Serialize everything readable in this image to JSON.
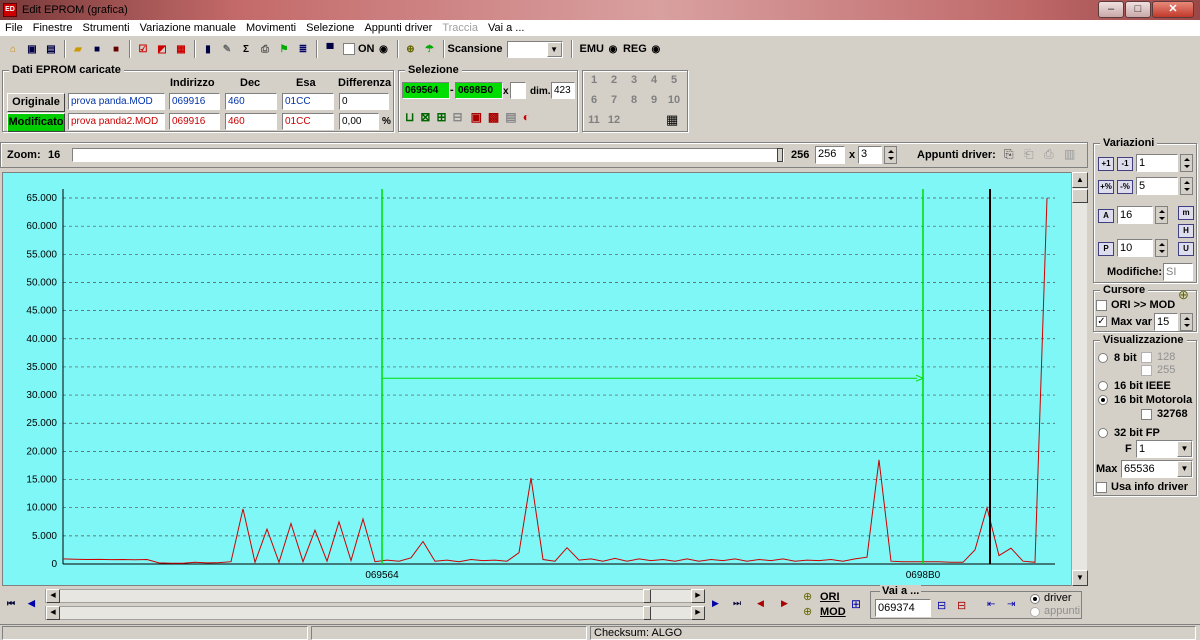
{
  "window": {
    "title": "Edit EPROM (grafica)",
    "icon_text": "EDT\nEPROM"
  },
  "menu": [
    "File",
    "Finestre",
    "Strumenti",
    "Variazione manuale",
    "Movimenti",
    "Selezione",
    "Appunti driver",
    "Traccia",
    "Vai a ..."
  ],
  "menu_disabled": [
    7
  ],
  "toolbar": {
    "on_label": "ON",
    "scansione_label": "Scansione",
    "scansione_value": "",
    "emu_label": "EMU",
    "reg_label": "REG",
    "on_checked": false
  },
  "dati": {
    "title": "Dati EPROM caricate",
    "headers": {
      "indirizzo": "Indirizzo",
      "dec": "Dec",
      "esa": "Esa",
      "differenza": "Differenza"
    },
    "originale": {
      "label": "Originale",
      "file": "prova panda.MOD",
      "indirizzo": "069916",
      "dec": "460",
      "esa": "01CC",
      "differenza": "0"
    },
    "modificato": {
      "label": "Modificato",
      "file": "prova panda2.MOD",
      "indirizzo": "069916",
      "dec": "460",
      "esa": "01CC",
      "differenza": "0,00",
      "unit": "%"
    }
  },
  "selezione": {
    "title": "Selezione",
    "start": "069564",
    "end": "0698B0",
    "x": "x",
    "dim_label": "dim.",
    "dim": "423"
  },
  "numgrid": [
    "1",
    "2",
    "3",
    "4",
    "5",
    "6",
    "7",
    "8",
    "9",
    "10",
    "11",
    "12"
  ],
  "zoom": {
    "label": "Zoom:",
    "value": "16",
    "max": "256",
    "field": "256",
    "x": "x",
    "mult": "3",
    "appunti_label": "Appunti driver:"
  },
  "chart_data": {
    "type": "line",
    "y_ticks": [
      "65.000",
      "60.000",
      "55.000",
      "50.000",
      "45.000",
      "40.000",
      "35.000",
      "30.000",
      "25.000",
      "20.000",
      "15.000",
      "10.000",
      "5.000",
      "0"
    ],
    "ylim": [
      0,
      65536
    ],
    "x_markers": [
      "069564",
      "0698B0"
    ],
    "background_color": "#7ff7f7",
    "line_color": "#cc0000",
    "selection_color": "#00dd00",
    "cursor_color": "#000000",
    "series": [
      {
        "values": [
          900,
          850,
          800,
          820,
          780,
          800,
          760,
          800,
          200,
          150,
          150,
          300,
          200,
          250,
          400,
          9800,
          300,
          6200,
          300,
          7200,
          400,
          6000,
          500,
          7500,
          600,
          8000,
          400,
          700,
          500,
          1100,
          4000,
          500,
          700,
          400,
          800,
          600,
          700,
          500,
          2000,
          15300,
          800,
          500,
          2900,
          700,
          900,
          500,
          1000,
          500,
          900,
          600,
          800,
          500,
          900,
          500,
          800,
          600,
          900,
          500,
          800,
          600,
          900,
          500,
          700,
          600,
          800,
          500,
          900,
          1200,
          18500,
          500,
          400,
          400,
          400,
          400,
          300,
          300,
          2500,
          10000,
          1500,
          2800,
          500,
          300,
          65000
        ]
      }
    ]
  },
  "variazioni": {
    "title": "Variazioni",
    "field1": "1",
    "field2": "5",
    "field3": "16",
    "field4": "10",
    "modifiche_label": "Modifiche:",
    "modifiche_value": "SI"
  },
  "cursore": {
    "title": "Cursore",
    "ori_mod": "ORI >> MOD",
    "maxvar_label": "Max var",
    "maxvar_value": "15"
  },
  "visualizzazione": {
    "title": "Visualizzazione",
    "bit8": "8 bit",
    "v128": "128",
    "v255": "255",
    "ieee": "16 bit IEEE",
    "motorola": "16 bit Motorola",
    "v32768": "32768",
    "fp32": "32 bit FP",
    "f_label": "F",
    "f_value": "1",
    "max_label": "Max",
    "max_value": "65536",
    "usa_info": "Usa info driver"
  },
  "bottom": {
    "ori": "ORI",
    "mod": "MOD",
    "vai_label": "Vai a ...",
    "vai_value": "069374",
    "driver": "driver",
    "appunti": "appunti"
  },
  "status": {
    "checksum": "Checksum: ALGO"
  }
}
